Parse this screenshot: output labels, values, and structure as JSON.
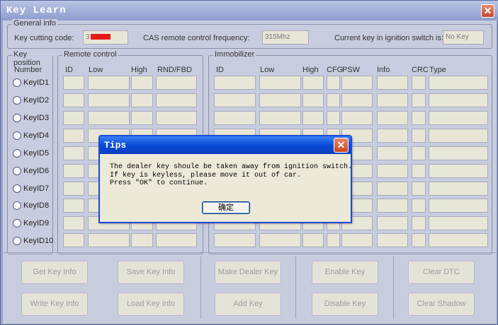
{
  "window": {
    "title": "Key Learn",
    "close_glyph": "✕"
  },
  "general_info": {
    "legend": "General info",
    "key_cutting_code_label": "Key cutting code:",
    "key_cutting_code_value": "3",
    "cas_label": "CAS remote control frequency:",
    "cas_value": "315Mhz",
    "current_key_label": "Current key in ignition switch is:",
    "current_key_value": "No Key"
  },
  "key_position": {
    "legend": "Key position",
    "number_header": "Number",
    "items": [
      "KeyID1",
      "KeyID2",
      "KeyID3",
      "KeyID4",
      "KeyID5",
      "KeyID6",
      "KeyID7",
      "KeyID8",
      "KeyID9",
      "KeyID10"
    ]
  },
  "remote_control": {
    "legend": "Remote control",
    "headers": [
      "ID",
      "Low",
      "High",
      "RND/FBD"
    ]
  },
  "immobilizer": {
    "legend": "Immobilizer",
    "headers": [
      "ID",
      "Low",
      "High",
      "CFG",
      "PSW",
      "Info",
      "CRC",
      "Type"
    ]
  },
  "buttons": {
    "get_key_info": "Get Key Info",
    "save_key_info": "Save Key Info",
    "write_key_info": "Write Key Info",
    "load_key_info": "Load Key Info",
    "make_dealer_key": "Make Dealer Key",
    "add_key": "Add Key",
    "enable_key": "Enable Key",
    "disable_key": "Disable Key",
    "clear_dtc": "Clear DTC",
    "clear_shadow": "Clear Shadow"
  },
  "dialog": {
    "title": "Tips",
    "close_glyph": "✕",
    "line1": "The dealer key shoule be taken away from ignition switch.",
    "line2": "If key is keyless, please move it out of car.",
    "line3": "Press \"OK\" to continue.",
    "ok_label": "确定"
  }
}
